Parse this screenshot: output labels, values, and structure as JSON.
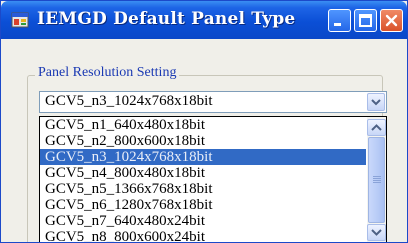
{
  "window": {
    "title": "IEMGD Default Panel Type",
    "icon": "app-icon",
    "controls": [
      "minimize-icon",
      "maximize-icon",
      "close-icon"
    ]
  },
  "group": {
    "legend": "Panel Resolution Setting"
  },
  "combo": {
    "value": "GCV5_n3_1024x768x18bit",
    "button_icon": "chevron-down-icon"
  },
  "dropdown": {
    "items": [
      "GCV5_n1_640x480x18bit",
      "GCV5_n2_800x600x18bit",
      "GCV5_n3_1024x768x18bit",
      "GCV5_n4_800x480x18bit",
      "GCV5_n5_1366x768x18bit",
      "GCV5_n6_1280x768x18bit",
      "GCV5_n7_640x480x24bit",
      "GCV5_n8_800x600x24bit"
    ],
    "selected_index": 2
  },
  "colors": {
    "titlebar": "#0b4fd6",
    "selection": "#316ac5",
    "legend_text": "#1a39b3",
    "close_button": "#d9522a"
  }
}
